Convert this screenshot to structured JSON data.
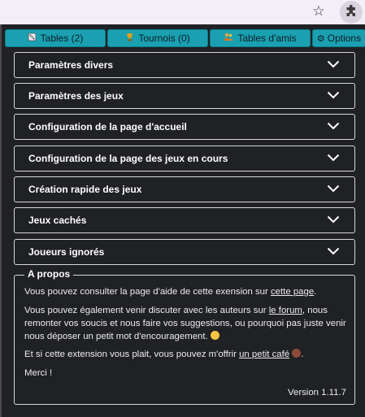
{
  "browser": {
    "bookmark_icon": "star-icon",
    "extension_icon": "puzzle-icon"
  },
  "tabs": [
    {
      "label": "Tables (2)",
      "icon": "dice-icon"
    },
    {
      "label": "Tournois (0)",
      "icon": "trophy-icon"
    },
    {
      "label": "Tables d'amis",
      "icon": "friends-icon"
    },
    {
      "label": "Options",
      "icon": "gear-icon"
    }
  ],
  "sections": [
    {
      "label": "Paramètres divers"
    },
    {
      "label": "Paramètres des jeux"
    },
    {
      "label": "Configuration de la page d'accueil"
    },
    {
      "label": "Configuration de la page des jeux en cours"
    },
    {
      "label": "Création rapide des jeux"
    },
    {
      "label": "Jeux cachés"
    },
    {
      "label": "Joueurs ignorés"
    }
  ],
  "about": {
    "title": "A propos",
    "p1_text": "Vous pouvez consulter la page d'aide de cette exension sur ",
    "p1_link": "cette page",
    "p1_end": ".",
    "p2_text": "Vous pouvez également venir discuter avec les auteurs sur ",
    "p2_link": "le forum",
    "p2_end": ", nous remonter vos soucis et nous faire vos suggestions, ou pourquoi pas juste venir nous déposer un petit mot d'encouragement.",
    "p3_text": "Et si cette extension vous plait, vous pouvez m'offrir ",
    "p3_link": "un petit café",
    "p3_end": ".",
    "p4": "Merci !",
    "version": "Version 1.11.7"
  },
  "colors": {
    "tab_bg": "#1aa0b1",
    "popup_bg": "#202124",
    "border": "#d8d8d8"
  }
}
